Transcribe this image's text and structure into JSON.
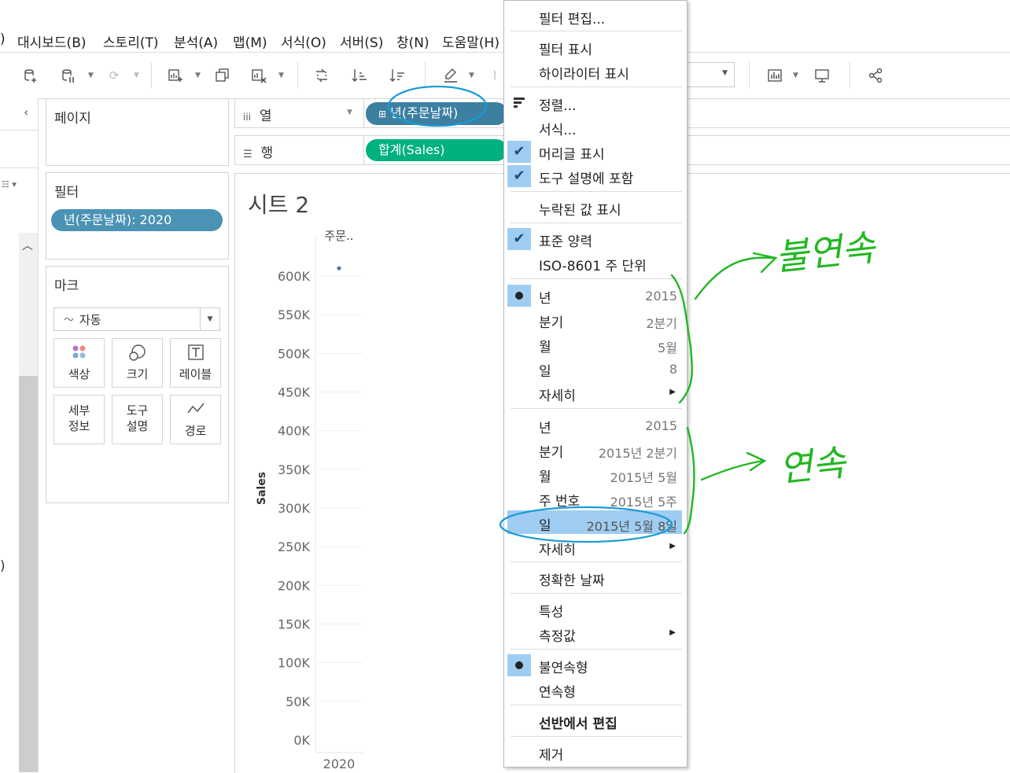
{
  "menubar": {
    "items": [
      "대시보드(B)",
      "스토리(T)",
      "분석(A)",
      "맵(M)",
      "서식(O)",
      "서버(S)",
      "창(N)",
      "도움말(H)"
    ]
  },
  "cards": {
    "pages_title": "페이지",
    "filters_title": "필터",
    "filter_pill": "년(주문날짜): 2020",
    "marks_title": "마크",
    "marks_type": "자동",
    "mark_buttons": [
      "색상",
      "크기",
      "레이블",
      "세부\n정보",
      "도구\n설명",
      "경로"
    ]
  },
  "shelves": {
    "columns_label": "열",
    "rows_label": "행",
    "columns_pill": "년(주문날짜)",
    "rows_pill": "합계(Sales)"
  },
  "sheet": {
    "title": "시트 2",
    "header": "주문..",
    "y_axis_label": "Sales",
    "x_tick": "2020"
  },
  "chart_data": {
    "type": "scatter",
    "categories": [
      "2020"
    ],
    "values": [
      610000
    ],
    "ylabel": "Sales",
    "ylim": [
      0,
      600000
    ],
    "y_ticks": [
      "600K",
      "550K",
      "500K",
      "450K",
      "400K",
      "350K",
      "300K",
      "250K",
      "200K",
      "150K",
      "100K",
      "50K",
      "0K"
    ],
    "x_tick_labels": [
      "2020"
    ],
    "column_header": "주문..",
    "mark_color": "#4e79a7"
  },
  "context_menu": {
    "items": [
      {
        "label": "필터 편집..."
      },
      {
        "label": "필터 표시"
      },
      {
        "label": "하이라이터 표시"
      },
      {
        "label": "정렬..."
      },
      {
        "label": "서식..."
      },
      {
        "label": "머리글 표시"
      },
      {
        "label": "도구 설명에 포함"
      },
      {
        "label": "누락된 값 표시"
      },
      {
        "label": "표준 양력"
      },
      {
        "label": "ISO-8601 주 단위"
      },
      {
        "label": "년",
        "value": "2015"
      },
      {
        "label": "분기",
        "value": "2분기"
      },
      {
        "label": "월",
        "value": "5월"
      },
      {
        "label": "일",
        "value": "8"
      },
      {
        "label": "자세히"
      },
      {
        "label": "년",
        "value": "2015"
      },
      {
        "label": "분기",
        "value": "2015년 2분기"
      },
      {
        "label": "월",
        "value": "2015년 5월"
      },
      {
        "label": "주 번호",
        "value": "2015년 5주"
      },
      {
        "label": "일",
        "value": "2015년 5월 8일"
      },
      {
        "label": "자세히"
      },
      {
        "label": "정확한 날짜"
      },
      {
        "label": "특성"
      },
      {
        "label": "측정값"
      },
      {
        "label": "불연속형"
      },
      {
        "label": "연속형"
      },
      {
        "label": "선반에서 편집"
      },
      {
        "label": "제거"
      }
    ]
  },
  "annotations": {
    "discrete_note": "불연속",
    "continuous_note": "연속",
    "ink_color": "#22b722",
    "highlight_color": "#1a9ad6"
  },
  "colors": {
    "discrete_pill": "#4a93b5",
    "continuous_pill": "#00b180",
    "menu_check_bg": "#9fcdf2"
  }
}
